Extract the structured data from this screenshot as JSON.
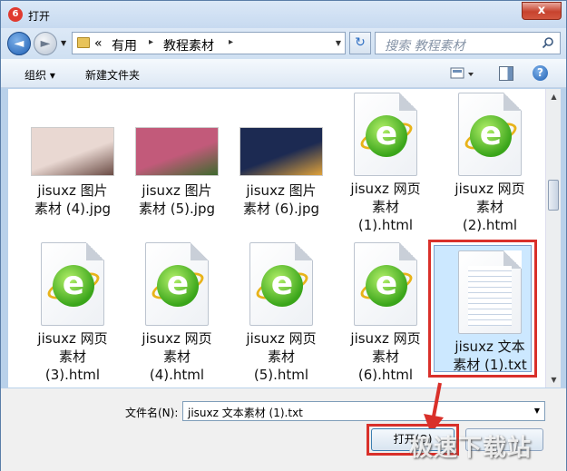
{
  "window": {
    "title": "打开",
    "close": "x"
  },
  "nav": {
    "back_glyph": "◄",
    "forward_glyph": "►",
    "address": {
      "prefix": "«",
      "segments": [
        "有用",
        "教程素材"
      ],
      "separator": "▸"
    },
    "refresh_glyph": "↻",
    "search_placeholder": "搜索 教程素材"
  },
  "toolbar": {
    "organize": "组织 ▾",
    "new_folder": "新建文件夹",
    "help": "?"
  },
  "files": [
    {
      "label": "jisuxz 图片\n素材 (4).jpg",
      "kind": "image",
      "color": "#e9d8d2",
      "accent": "#6b4c45"
    },
    {
      "label": "jisuxz 图片\n素材 (5).jpg",
      "kind": "image",
      "color": "#c25a7a",
      "accent": "#3e6a2e"
    },
    {
      "label": "jisuxz 图片\n素材 (6).jpg",
      "kind": "image",
      "color": "#1c2a52",
      "accent": "#e0a23a"
    },
    {
      "label": "jisuxz 网页\n素材\n(1).html",
      "kind": "html"
    },
    {
      "label": "jisuxz 网页\n素材\n(2).html",
      "kind": "html"
    },
    {
      "label": "jisuxz 网页\n素材\n(3).html",
      "kind": "html"
    },
    {
      "label": "jisuxz 网页\n素材\n(4).html",
      "kind": "html"
    },
    {
      "label": "jisuxz 网页\n素材\n(5).html",
      "kind": "html"
    },
    {
      "label": "jisuxz 网页\n素材\n(6).html",
      "kind": "html"
    },
    {
      "label": "jisuxz 文本\n素材 (1).txt",
      "kind": "txt",
      "selected": true
    }
  ],
  "bottom": {
    "filename_label": "文件名(N):",
    "filename_value": "jisuxz 文本素材 (1).txt",
    "open_label": "打开(O)",
    "watermark": "极速下载站"
  },
  "colors": {
    "highlight": "#d9302a",
    "selection": "#cce8ff"
  }
}
